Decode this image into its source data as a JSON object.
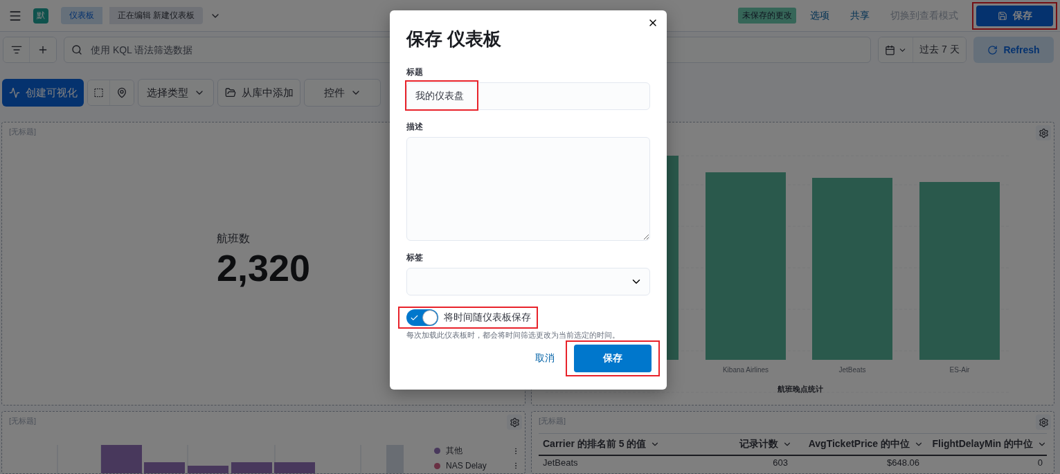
{
  "header": {
    "avatar": "默",
    "breadcrumbs": [
      {
        "label": "仪表板",
        "selected": false
      },
      {
        "label": "正在编辑 新建仪表板",
        "selected": true
      }
    ],
    "unsaved_badge": "未保存的更改",
    "links": [
      {
        "label": "选项",
        "disabled": false
      },
      {
        "label": "共享",
        "disabled": false
      },
      {
        "label": "切换到查看模式",
        "disabled": true
      }
    ],
    "save_button": {
      "label": "保存",
      "highlighted": true
    }
  },
  "query_bar": {
    "placeholder": "使用 KQL 语法筛选数据",
    "time_range": "过去 7 天",
    "refresh": "Refresh"
  },
  "toolbar": {
    "create": "创建可视化",
    "type_select": "选择类型",
    "add_from_library": "从库中添加",
    "controls": "控件"
  },
  "panels": [
    {
      "kind": "metric",
      "title": "[无标题]",
      "label": "航班数",
      "value": "2,320"
    },
    {
      "kind": "bar",
      "categories": [
        "Kibana Airlines",
        "JetBeats",
        "ES-Air"
      ],
      "xlabel": "航班晚点统计"
    },
    {
      "kind": "stacked",
      "title": "[无标题]",
      "legend": [
        {
          "name": "其他",
          "color": "#48385c"
        },
        {
          "name": "NAS Delay",
          "color": "#693043"
        }
      ]
    },
    {
      "kind": "table",
      "title": "[无标题]",
      "columns": [
        "Carrier 的排名前 5 的值",
        "记录计数",
        "AvgTicketPrice 的中位",
        "FlightDelayMin 的中位"
      ],
      "rows": [
        [
          "JetBeats",
          "603",
          "$648.06",
          "0"
        ]
      ]
    }
  ],
  "modal": {
    "title": "保存 仪表板",
    "fields": [
      {
        "kind": "text",
        "label": "标题",
        "value": "我的仪表盘",
        "highlighted": true
      },
      {
        "kind": "textarea",
        "label": "描述"
      },
      {
        "kind": "combo",
        "label": "标签"
      }
    ],
    "toggle": {
      "label": "将时间随仪表板保存",
      "on": true,
      "highlighted": true
    },
    "help": "每次加载此仪表板时，都会将时间筛选更改为当前选定的时间。",
    "cancel": "取消",
    "save": {
      "label": "保存",
      "highlighted": true
    }
  }
}
